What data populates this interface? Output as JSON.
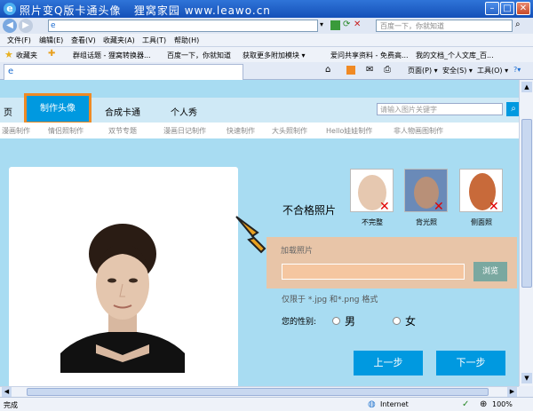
{
  "window": {
    "title": "照片变Q版卡通头像   狸窝家园 www.leawo.cn"
  },
  "address": {
    "search_placeholder": "百度一下，你就知道"
  },
  "menu": [
    "文件(F)",
    "编辑(E)",
    "查看(V)",
    "收藏夹(A)",
    "工具(T)",
    "帮助(H)"
  ],
  "favorites": {
    "label": "收藏夹",
    "items": [
      "群组话题 - 狸窝转换器...",
      "百度一下，你就知道",
      "获取更多附加模块 ▾",
      "爱问共享资料 - 免费高...",
      "我的文档_个人文库_百..."
    ]
  },
  "toolbar": {
    "page": "页面(P) ▾",
    "safety": "安全(S) ▾",
    "tools": "工具(O) ▾",
    "help": "?▾"
  },
  "nav": {
    "tabs": [
      "页",
      "制作头像",
      "合成卡通",
      "个人秀"
    ],
    "search_placeholder": "请输入图片关键字"
  },
  "subnav": [
    "漫画制作",
    "情侣照制作",
    "双节专题",
    "漫画日记制作",
    "快速制作",
    "大头照制作",
    "Hello娃娃制作",
    "非人物画图制作"
  ],
  "panel": {
    "bad_photos_title": "不合格照片",
    "samples": [
      "不完整",
      "背光照",
      "侧面照"
    ],
    "load_label": "加载照片",
    "browse": "浏览",
    "format_hint": "仅限于 *.jpg 和*.png 格式",
    "gender_label": "您的性别:",
    "male": "男",
    "female": "女",
    "prev": "上一步",
    "next": "下一步"
  },
  "status": {
    "left": "完成",
    "zone": "Internet",
    "zoom": "100%"
  },
  "colors": {
    "accent": "#0099e0",
    "highlight": "#f08a24",
    "load_bg": "#e8c5a8"
  }
}
